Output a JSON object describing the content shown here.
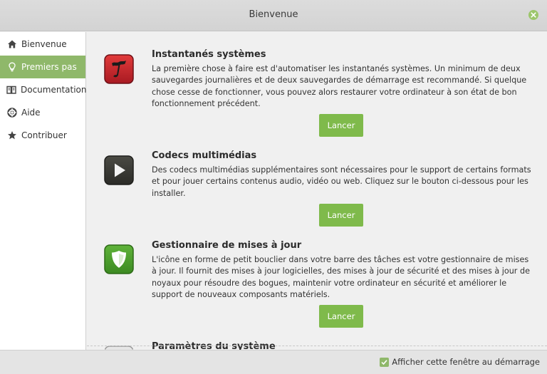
{
  "window": {
    "title": "Bienvenue"
  },
  "sidebar": {
    "items": [
      {
        "label": "Bienvenue",
        "icon": "home-icon",
        "active": false
      },
      {
        "label": "Premiers pas",
        "icon": "lightbulb-icon",
        "active": true
      },
      {
        "label": "Documentation",
        "icon": "book-icon",
        "active": false
      },
      {
        "label": "Aide",
        "icon": "lifebuoy-icon",
        "active": false
      },
      {
        "label": "Contribuer",
        "icon": "star-icon",
        "active": false
      }
    ]
  },
  "sections": [
    {
      "title": "Instantanés systèmes",
      "icon": "timeshift-icon",
      "description": "La première chose à faire est d'automatiser les instantanés systèmes. Un minimum de deux sauvegardes journalières et de deux sauvegardes de démarrage est recommandé. Si quelque chose cesse de fonctionner, vous pouvez alors restaurer votre ordinateur à son état de bon fonctionnement précédent.",
      "button": "Lancer"
    },
    {
      "title": "Codecs multimédias",
      "icon": "play-icon",
      "description": "Des codecs multimédias supplémentaires sont nécessaires pour le support de certains formats et pour jouer certains contenus audio, vidéo ou web. Cliquez sur le bouton ci-dessous pour les installer.",
      "button": "Lancer"
    },
    {
      "title": "Gestionnaire de mises à jour",
      "icon": "shield-icon",
      "description": "L'icône en forme de petit bouclier dans votre barre des tâches est votre gestionnaire de mises à jour. Il fournit des mises à jour logicielles, des mises à jour de sécurité et des mises à jour de noyaux pour résoudre des bogues, maintenir votre ordinateur en sécurité et améliorer le support de nouveaux composants matériels.",
      "button": "Lancer"
    },
    {
      "title": "Paramètres du système",
      "icon": "settings-icon"
    }
  ],
  "footer": {
    "checkbox_label": "Afficher cette fenêtre au démarrage",
    "checked": true
  },
  "colors": {
    "accent": "#8fb86a",
    "button": "#7fba4b",
    "timeshift_red": "#c4262e",
    "shield_green": "#4c9a2a"
  }
}
